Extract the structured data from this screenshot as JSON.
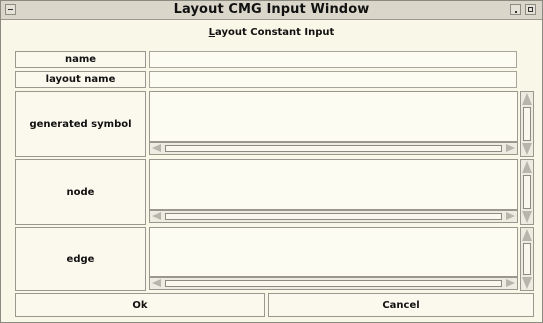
{
  "window": {
    "title": "Layout CMG Input Window"
  },
  "header": {
    "text_underlined": "L",
    "text_rest": "ayout Constant Input"
  },
  "fields": {
    "name_label": "name",
    "name_value": "",
    "layout_name_label": "layout name",
    "layout_name_value": "",
    "generated_symbol_label": "generated symbol",
    "generated_symbol_value": "",
    "node_label": "node",
    "node_value": "",
    "edge_label": "edge",
    "edge_value": ""
  },
  "buttons": {
    "ok_label": "Ok",
    "cancel_label": "Cancel"
  }
}
